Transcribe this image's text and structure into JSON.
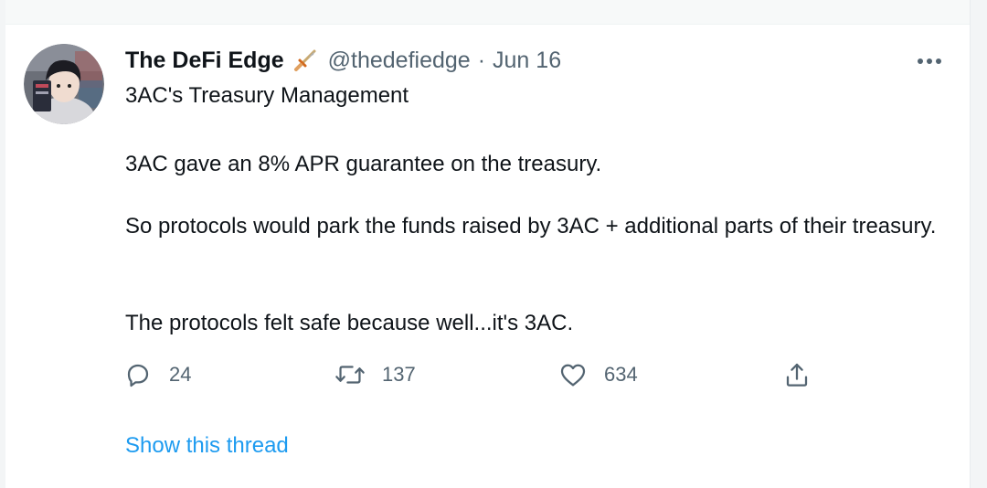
{
  "tweet": {
    "author": {
      "name": "The DeFi Edge",
      "badge_icon": "dagger-icon",
      "handle": "@thedefiedge",
      "separator": "·",
      "date": "Jun 16"
    },
    "more_icon": "more-dots-icon",
    "paragraphs": [
      "3AC's Treasury Management",
      "3AC gave an 8% APR guarantee on the treasury.",
      "So protocols would park the funds raised by 3AC + additional parts of their treasury.",
      "The protocols felt safe because well...it's 3AC."
    ],
    "actions": {
      "reply": {
        "icon": "reply-icon",
        "count": "24"
      },
      "retweet": {
        "icon": "retweet-icon",
        "count": "137"
      },
      "like": {
        "icon": "heart-icon",
        "count": "634"
      },
      "share": {
        "icon": "share-icon"
      }
    },
    "show_thread": "Show this thread"
  },
  "colors": {
    "text": "#0f1419",
    "secondary": "#536471",
    "link": "#1d9bf0"
  }
}
